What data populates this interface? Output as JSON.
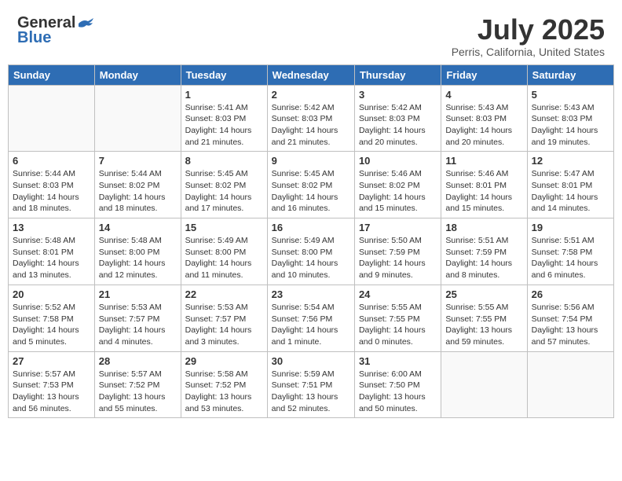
{
  "header": {
    "logo_general": "General",
    "logo_blue": "Blue",
    "title": "July 2025",
    "location": "Perris, California, United States"
  },
  "days_of_week": [
    "Sunday",
    "Monday",
    "Tuesday",
    "Wednesday",
    "Thursday",
    "Friday",
    "Saturday"
  ],
  "weeks": [
    [
      {
        "day": "",
        "info": ""
      },
      {
        "day": "",
        "info": ""
      },
      {
        "day": "1",
        "info": "Sunrise: 5:41 AM\nSunset: 8:03 PM\nDaylight: 14 hours\nand 21 minutes."
      },
      {
        "day": "2",
        "info": "Sunrise: 5:42 AM\nSunset: 8:03 PM\nDaylight: 14 hours\nand 21 minutes."
      },
      {
        "day": "3",
        "info": "Sunrise: 5:42 AM\nSunset: 8:03 PM\nDaylight: 14 hours\nand 20 minutes."
      },
      {
        "day": "4",
        "info": "Sunrise: 5:43 AM\nSunset: 8:03 PM\nDaylight: 14 hours\nand 20 minutes."
      },
      {
        "day": "5",
        "info": "Sunrise: 5:43 AM\nSunset: 8:03 PM\nDaylight: 14 hours\nand 19 minutes."
      }
    ],
    [
      {
        "day": "6",
        "info": "Sunrise: 5:44 AM\nSunset: 8:03 PM\nDaylight: 14 hours\nand 18 minutes."
      },
      {
        "day": "7",
        "info": "Sunrise: 5:44 AM\nSunset: 8:02 PM\nDaylight: 14 hours\nand 18 minutes."
      },
      {
        "day": "8",
        "info": "Sunrise: 5:45 AM\nSunset: 8:02 PM\nDaylight: 14 hours\nand 17 minutes."
      },
      {
        "day": "9",
        "info": "Sunrise: 5:45 AM\nSunset: 8:02 PM\nDaylight: 14 hours\nand 16 minutes."
      },
      {
        "day": "10",
        "info": "Sunrise: 5:46 AM\nSunset: 8:02 PM\nDaylight: 14 hours\nand 15 minutes."
      },
      {
        "day": "11",
        "info": "Sunrise: 5:46 AM\nSunset: 8:01 PM\nDaylight: 14 hours\nand 15 minutes."
      },
      {
        "day": "12",
        "info": "Sunrise: 5:47 AM\nSunset: 8:01 PM\nDaylight: 14 hours\nand 14 minutes."
      }
    ],
    [
      {
        "day": "13",
        "info": "Sunrise: 5:48 AM\nSunset: 8:01 PM\nDaylight: 14 hours\nand 13 minutes."
      },
      {
        "day": "14",
        "info": "Sunrise: 5:48 AM\nSunset: 8:00 PM\nDaylight: 14 hours\nand 12 minutes."
      },
      {
        "day": "15",
        "info": "Sunrise: 5:49 AM\nSunset: 8:00 PM\nDaylight: 14 hours\nand 11 minutes."
      },
      {
        "day": "16",
        "info": "Sunrise: 5:49 AM\nSunset: 8:00 PM\nDaylight: 14 hours\nand 10 minutes."
      },
      {
        "day": "17",
        "info": "Sunrise: 5:50 AM\nSunset: 7:59 PM\nDaylight: 14 hours\nand 9 minutes."
      },
      {
        "day": "18",
        "info": "Sunrise: 5:51 AM\nSunset: 7:59 PM\nDaylight: 14 hours\nand 8 minutes."
      },
      {
        "day": "19",
        "info": "Sunrise: 5:51 AM\nSunset: 7:58 PM\nDaylight: 14 hours\nand 6 minutes."
      }
    ],
    [
      {
        "day": "20",
        "info": "Sunrise: 5:52 AM\nSunset: 7:58 PM\nDaylight: 14 hours\nand 5 minutes."
      },
      {
        "day": "21",
        "info": "Sunrise: 5:53 AM\nSunset: 7:57 PM\nDaylight: 14 hours\nand 4 minutes."
      },
      {
        "day": "22",
        "info": "Sunrise: 5:53 AM\nSunset: 7:57 PM\nDaylight: 14 hours\nand 3 minutes."
      },
      {
        "day": "23",
        "info": "Sunrise: 5:54 AM\nSunset: 7:56 PM\nDaylight: 14 hours\nand 1 minute."
      },
      {
        "day": "24",
        "info": "Sunrise: 5:55 AM\nSunset: 7:55 PM\nDaylight: 14 hours\nand 0 minutes."
      },
      {
        "day": "25",
        "info": "Sunrise: 5:55 AM\nSunset: 7:55 PM\nDaylight: 13 hours\nand 59 minutes."
      },
      {
        "day": "26",
        "info": "Sunrise: 5:56 AM\nSunset: 7:54 PM\nDaylight: 13 hours\nand 57 minutes."
      }
    ],
    [
      {
        "day": "27",
        "info": "Sunrise: 5:57 AM\nSunset: 7:53 PM\nDaylight: 13 hours\nand 56 minutes."
      },
      {
        "day": "28",
        "info": "Sunrise: 5:57 AM\nSunset: 7:52 PM\nDaylight: 13 hours\nand 55 minutes."
      },
      {
        "day": "29",
        "info": "Sunrise: 5:58 AM\nSunset: 7:52 PM\nDaylight: 13 hours\nand 53 minutes."
      },
      {
        "day": "30",
        "info": "Sunrise: 5:59 AM\nSunset: 7:51 PM\nDaylight: 13 hours\nand 52 minutes."
      },
      {
        "day": "31",
        "info": "Sunrise: 6:00 AM\nSunset: 7:50 PM\nDaylight: 13 hours\nand 50 minutes."
      },
      {
        "day": "",
        "info": ""
      },
      {
        "day": "",
        "info": ""
      }
    ]
  ]
}
